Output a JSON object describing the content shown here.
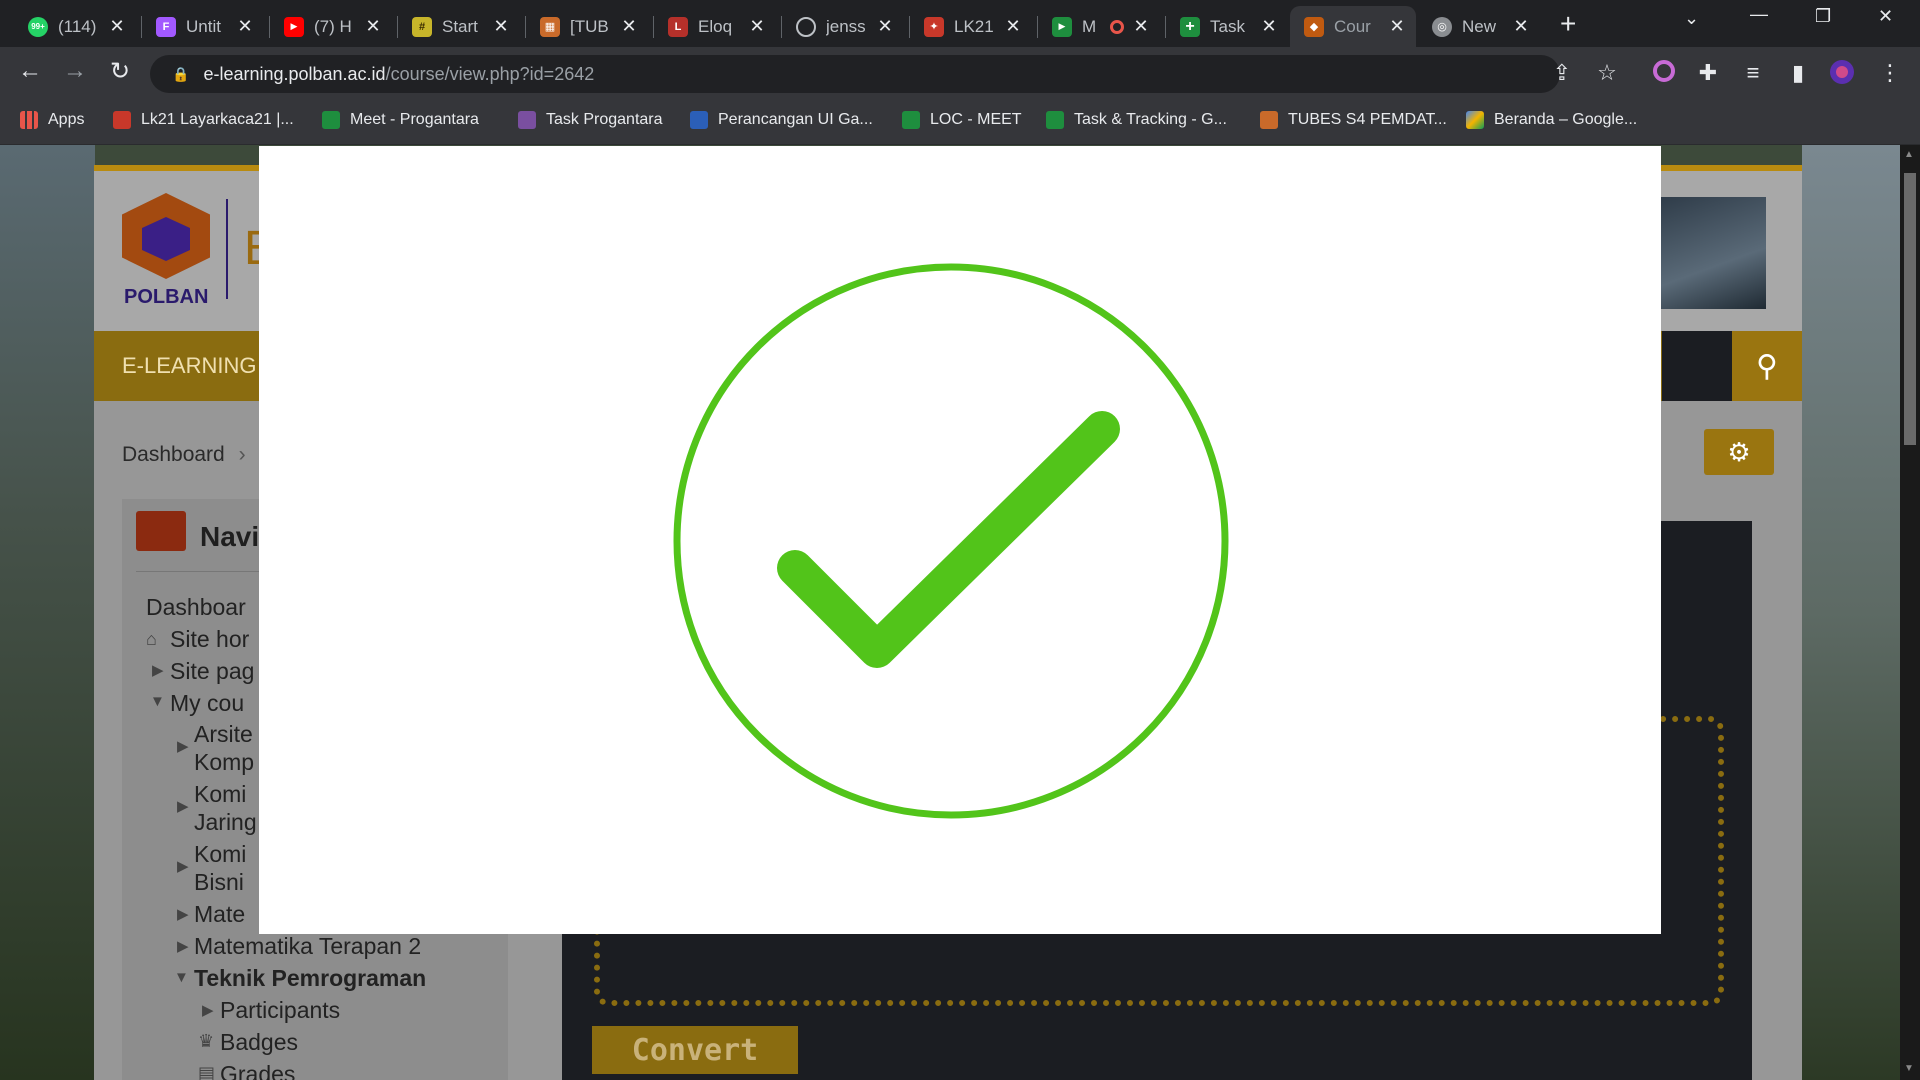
{
  "browser": {
    "tabs": [
      {
        "title": "(114)",
        "icon": "whatsapp-icon",
        "color": "#25d366",
        "glyph": "99+"
      },
      {
        "title": "Untit",
        "icon": "figma-icon",
        "color": "#a259ff",
        "glyph": "F"
      },
      {
        "title": "(7) H",
        "icon": "youtube-icon",
        "color": "#ff0000",
        "glyph": "▶"
      },
      {
        "title": "Start",
        "icon": "start-icon",
        "color": "#c7b52a",
        "glyph": "#"
      },
      {
        "title": "[TUB",
        "icon": "doc-icon",
        "color": "#c96a2a",
        "glyph": "▦"
      },
      {
        "title": "Eloq",
        "icon": "laravel-icon",
        "color": "#b5302a",
        "glyph": "L"
      },
      {
        "title": "jenss",
        "icon": "github-icon",
        "color": "#3a3b3f",
        "glyph": "◯"
      },
      {
        "title": "LK21",
        "icon": "lk21-icon",
        "color": "#c8382a",
        "glyph": "✦"
      },
      {
        "title": "M",
        "icon": "meet-icon",
        "color": "#1e8e3e",
        "glyph": "▶"
      },
      {
        "title": "Task",
        "icon": "sheets-icon",
        "color": "#1e8e3e",
        "glyph": "+"
      },
      {
        "title": "Cour",
        "icon": "polban-icon",
        "color": "#c05a10",
        "glyph": "◆"
      },
      {
        "title": "New",
        "icon": "chrome-icon",
        "color": "#8a8d91",
        "glyph": "◎"
      }
    ],
    "url_host": "e-learning.polban.ac.id",
    "url_path": "/course/view.php?id=2642",
    "bookmarks": [
      {
        "label": "Apps",
        "color": "#e8554a"
      },
      {
        "label": "Lk21 Layarkaca21 |...",
        "color": "#c8382a"
      },
      {
        "label": "Meet - Progantara",
        "color": "#1e8e3e"
      },
      {
        "label": "Task Progantara",
        "color": "#7a4fa0"
      },
      {
        "label": "Perancangan UI Ga...",
        "color": "#2b5fb8"
      },
      {
        "label": "LOC - MEET",
        "color": "#1e8e3e"
      },
      {
        "label": "Task & Tracking - G...",
        "color": "#1e8e3e"
      },
      {
        "label": "TUBES S4 PEMDAT...",
        "color": "#c96a2a"
      },
      {
        "label": "Beranda – Google...",
        "color": "#f4b400"
      }
    ]
  },
  "page": {
    "logo_text": "POLBAN",
    "site_title_fragment": "E",
    "navbar_label": "E-LEARNING",
    "breadcrumb": "Dashboard",
    "navblock_title": "Navi",
    "nav_items": [
      {
        "label": "Dashboar",
        "indent": 0
      },
      {
        "label": "Site hor",
        "indent": 0
      },
      {
        "label": "Site pag",
        "indent": 0
      },
      {
        "label": "My cou",
        "indent": 0
      },
      {
        "label": "Arsite",
        "indent": 1
      },
      {
        "label": "Komp",
        "indent": 1
      },
      {
        "label": "Komi",
        "indent": 1
      },
      {
        "label": "Jaring",
        "indent": 1
      },
      {
        "label": "Komi",
        "indent": 1
      },
      {
        "label": "Bisni",
        "indent": 1
      },
      {
        "label": "Mate",
        "indent": 1
      },
      {
        "label": "Matematika Terapan 2",
        "indent": 1
      },
      {
        "label": "Teknik Pemrograman",
        "indent": 1
      },
      {
        "label": "Participants",
        "indent": 2
      },
      {
        "label": "Badges",
        "indent": 2
      },
      {
        "label": "Grades",
        "indent": 2
      }
    ],
    "convert_label": "Convert"
  },
  "modal": {
    "icon": "success-check-icon",
    "color": "#52c41a"
  }
}
